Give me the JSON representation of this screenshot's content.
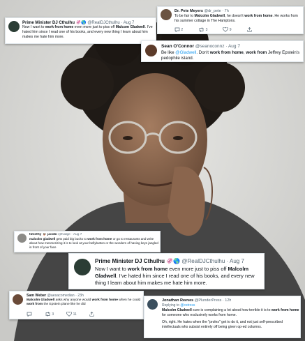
{
  "tweets": {
    "t1": {
      "name": "Prime Minister DJ Cthulhu",
      "emoji": "🦑🌎",
      "handle": "@RealDJCthulhu",
      "date": "· Aug 7",
      "text": [
        {
          "t": "Now I want to "
        },
        {
          "t": "work from home",
          "b": true
        },
        {
          "t": " even more just to piss off "
        },
        {
          "t": "Malcom Gladwell",
          "b": true
        },
        {
          "t": ".  I've hated him since I read one of his books, and every new thing I learn about him makes me hate him more."
        }
      ]
    },
    "t2": {
      "name": "Dr. Pete Meyers",
      "handle": "@dr_pete",
      "date": "· 7h",
      "text": [
        {
          "t": "To be fair to "
        },
        {
          "t": "Malcolm Gladwell",
          "b": true
        },
        {
          "t": ", he doesn't "
        },
        {
          "t": "work from home",
          "b": true
        },
        {
          "t": ". He works from his summer cottage in The Hamptons."
        }
      ],
      "actions": {
        "reply": "2",
        "retweet": "3",
        "like": "9"
      }
    },
    "t3": {
      "name": "Sean O'Connor",
      "handle": "@seanoconnz",
      "date": "· Aug 7",
      "text": [
        {
          "t": "Be like "
        },
        {
          "t": "@Gladwell",
          "m": true
        },
        {
          "t": ". Don't "
        },
        {
          "t": "work from home",
          "b": true
        },
        {
          "t": ", "
        },
        {
          "t": "work from",
          "b": true
        },
        {
          "t": " Jeffrey Epstein's pedophile island."
        }
      ]
    },
    "t4": {
      "name": "timothy 🦆 jacobi",
      "handle": "@tvidge",
      "date": "· Aug 7",
      "text": [
        {
          "t": "malcolm gladwell",
          "b": true
        },
        {
          "t": " gets paid big bucks to "
        },
        {
          "t": "work from home",
          "b": true
        },
        {
          "t": " or go to restaurants and write about how mesmerizing it is to look at your bellybutton or the wonders of having keys jangled in front of your face"
        }
      ]
    },
    "t5": {
      "name": "Prime Minister DJ Cthulhu",
      "emoji": "🦑🌎",
      "handle": "@RealDJCthulhu",
      "date": "· Aug 7",
      "text": [
        {
          "t": "Now I want to "
        },
        {
          "t": "work from home",
          "b": true
        },
        {
          "t": " even more just to piss off "
        },
        {
          "t": "Malcolm Gladwell",
          "b": true
        },
        {
          "t": ".  I've hated him since I read one of his books, and every new thing I learn about him makes me hate him more."
        }
      ]
    },
    "t6": {
      "name": "Sam Weber",
      "handle": "@aesacomedian",
      "date": "· 23h",
      "text": [
        {
          "t": "Malcolm Gladwell",
          "b": true
        },
        {
          "t": " asks why anyone would "
        },
        {
          "t": "work from home",
          "b": true
        },
        {
          "t": " when he could "
        },
        {
          "t": "work from",
          "b": true
        },
        {
          "t": " the Epstein plane like he did"
        }
      ],
      "actions": {
        "reply": "",
        "retweet": "3",
        "like": "11"
      }
    },
    "t7": {
      "name": "Jonathan Reeves",
      "handle": "@PlunderPress",
      "date": "· 12h",
      "replying_prefix": "Replying to ",
      "replying_handle": "@cstross",
      "para1": [
        {
          "t": "Malcolm Gladwell",
          "b": true
        },
        {
          "t": " sure is complaining a lot about how terrible it is to "
        },
        {
          "t": "work from home",
          "b": true
        },
        {
          "t": " for someone who exclusively works from home."
        }
      ],
      "para2": [
        {
          "t": "Oh, right. He hates when the \"proles\" get to do it, and not just self-prescribed intellectuals who subsist entirely off being given op-ed columns."
        }
      ]
    }
  },
  "colors": {
    "background": "#d9d9d6",
    "jacket": "#454545",
    "hair": "#1f1a16",
    "skin": "#8e6a52",
    "card_bg": "#ffffff",
    "text": "#0f1419",
    "meta": "#536471",
    "mention": "#1d9bf0"
  },
  "icons": [
    "reply-icon",
    "retweet-icon",
    "like-icon",
    "share-icon"
  ]
}
